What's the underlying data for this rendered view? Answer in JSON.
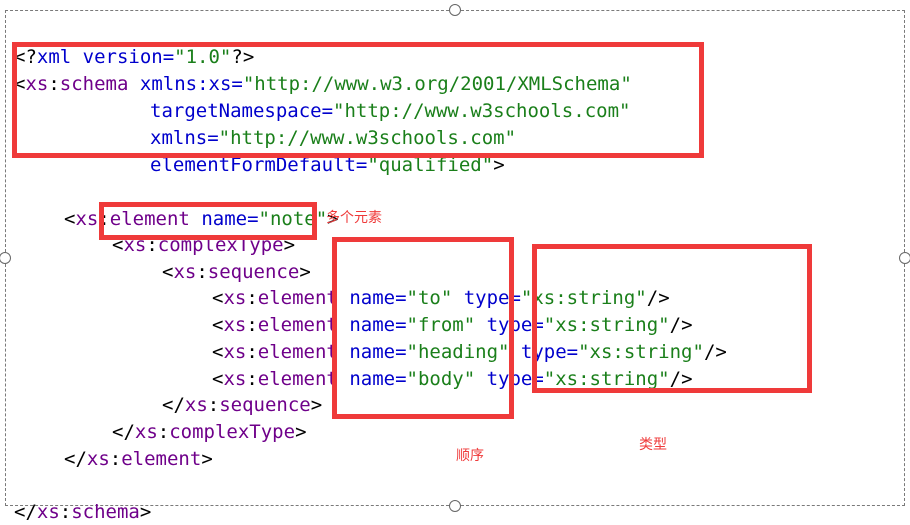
{
  "code": {
    "line1": {
      "open": "<?",
      "name": "xml",
      "attr": " version=",
      "value": "\"1.0\"",
      "close": "?>"
    },
    "line2": {
      "open": "<",
      "prefix": "xs",
      "sep": ":",
      "name": "schema",
      "attr": " xmlns:xs=",
      "value": "\"http://www.w3.org/2001/XMLSchema\""
    },
    "line3": {
      "attr": "targetNamespace=",
      "value": "\"http://www.w3schools.com\""
    },
    "line4": {
      "attr": "xmlns=",
      "value": "\"http://www.w3schools.com\""
    },
    "line5": {
      "attr": "elementFormDefault=",
      "value": "\"qualified\"",
      "close": ">"
    },
    "line6": {
      "open": "<",
      "prefix": "xs",
      "sep": ":",
      "name": "element",
      "attr": " name=",
      "value": "\"note\"",
      "close": ">"
    },
    "line7": {
      "open": "<",
      "prefix": "xs",
      "sep": ":",
      "name": "complexType",
      "close": ">"
    },
    "line8": {
      "open": "<",
      "prefix": "xs",
      "sep": ":",
      "name": "sequence",
      "close": ">"
    },
    "elements": [
      {
        "open": "<",
        "prefix": "xs",
        "sep": ":",
        "name": "element",
        "name_attr": " name=",
        "name_value": "\"to\"",
        "type_attr": " type=",
        "type_value": "\"xs:string\"",
        "close": "/>"
      },
      {
        "open": "<",
        "prefix": "xs",
        "sep": ":",
        "name": "element",
        "name_attr": " name=",
        "name_value": "\"from\"",
        "type_attr": " type=",
        "type_value": "\"xs:string\"",
        "close": "/>"
      },
      {
        "open": "<",
        "prefix": "xs",
        "sep": ":",
        "name": "element",
        "name_attr": " name=",
        "name_value": "\"heading\"",
        "type_attr": " type=",
        "type_value": "\"xs:string\"",
        "close": "/>"
      },
      {
        "open": "<",
        "prefix": "xs",
        "sep": ":",
        "name": "element",
        "name_attr": " name=",
        "name_value": "\"body\"",
        "type_attr": " type=",
        "type_value": "\"xs:string\"",
        "close": "/>"
      }
    ],
    "line13": {
      "open": "</",
      "prefix": "xs",
      "sep": ":",
      "name": "sequence",
      "close": ">"
    },
    "line14": {
      "open": "</",
      "prefix": "xs",
      "sep": ":",
      "name": "complexType",
      "close": ">"
    },
    "line15": {
      "open": "</",
      "prefix": "xs",
      "sep": ":",
      "name": "element",
      "close": ">"
    },
    "line17": {
      "open": "</",
      "prefix": "xs",
      "sep": ":",
      "name": "schema",
      "close": ">"
    }
  },
  "annotations": {
    "complex_type_note": "多个元素",
    "order_note": "顺序",
    "type_note": "类型"
  },
  "colors": {
    "highlight": "#ef3a3a",
    "tag": "#6f008a",
    "attribute": "#0000cc",
    "value": "#1a7f1a"
  }
}
